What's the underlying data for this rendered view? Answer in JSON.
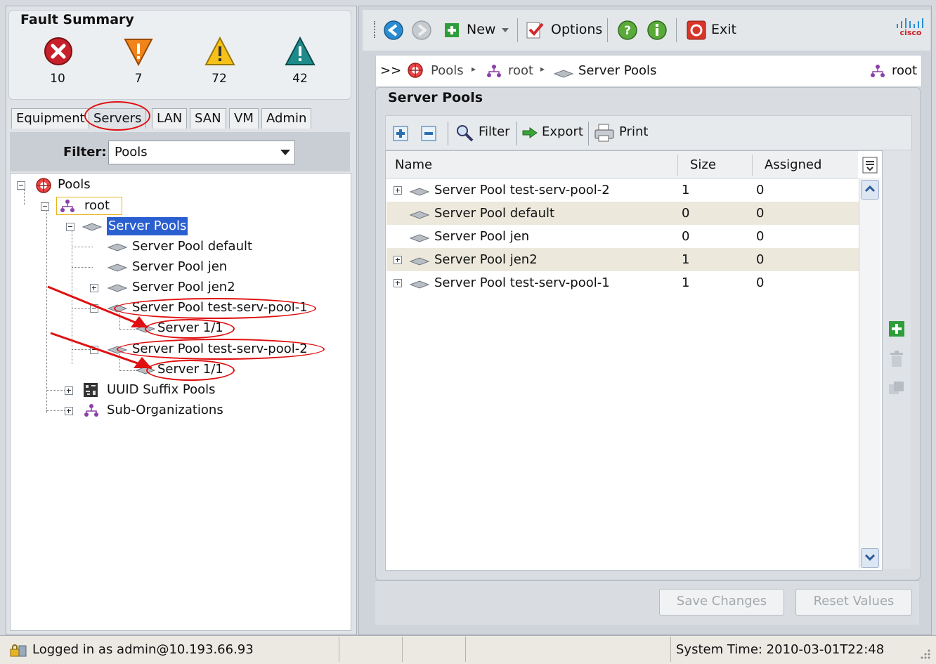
{
  "fault_summary": {
    "title": "Fault Summary",
    "items": [
      {
        "icon": "critical-fault-icon",
        "count": "10"
      },
      {
        "icon": "major-fault-icon",
        "count": "7"
      },
      {
        "icon": "minor-fault-icon",
        "count": "72"
      },
      {
        "icon": "warning-fault-icon",
        "count": "42"
      }
    ]
  },
  "nav_tabs": [
    "Equipment",
    "Servers",
    "LAN",
    "SAN",
    "VM",
    "Admin"
  ],
  "filter": {
    "label": "Filter:",
    "value": "Pools"
  },
  "tree": {
    "pools": "Pools",
    "root": "root",
    "server_pools": "Server Pools",
    "pool_default": "Server Pool default",
    "pool_jen": "Server Pool jen",
    "pool_jen2": "Server Pool jen2",
    "pool_test1": "Server Pool test-serv-pool-1",
    "server_1_1_a": "Server 1/1",
    "pool_test2": "Server Pool test-serv-pool-2",
    "server_1_1_b": "Server 1/1",
    "uuid_pools": "UUID Suffix Pools",
    "sub_orgs": "Sub-Organizations"
  },
  "toolbar": {
    "new_label": "New",
    "options_label": "Options",
    "exit_label": "Exit",
    "brand": "cisco"
  },
  "breadcrumb": {
    "prefix": ">>",
    "items": [
      "Pools",
      "root",
      "Server Pools"
    ],
    "right_label": "root"
  },
  "panel": {
    "title": "Server Pools",
    "filter_label": "Filter",
    "export_label": "Export",
    "print_label": "Print"
  },
  "grid": {
    "columns": [
      "Name",
      "Size",
      "Assigned"
    ],
    "rows": [
      {
        "name": "Server Pool test-serv-pool-2",
        "size": "1",
        "assigned": "0",
        "expandable": true
      },
      {
        "name": "Server Pool default",
        "size": "0",
        "assigned": "0",
        "expandable": false
      },
      {
        "name": "Server Pool jen",
        "size": "0",
        "assigned": "0",
        "expandable": false
      },
      {
        "name": "Server Pool jen2",
        "size": "1",
        "assigned": "0",
        "expandable": true
      },
      {
        "name": "Server Pool test-serv-pool-1",
        "size": "1",
        "assigned": "0",
        "expandable": true
      }
    ]
  },
  "buttons": {
    "save": "Save Changes",
    "reset": "Reset Values"
  },
  "status": {
    "login": "Logged in as admin@10.193.66.93",
    "time": "System Time: 2010-03-01T22:48"
  },
  "colors": {
    "annotation_red": "#e01010",
    "selection": "#2a5fd0",
    "alt_row": "#ece9dc"
  }
}
